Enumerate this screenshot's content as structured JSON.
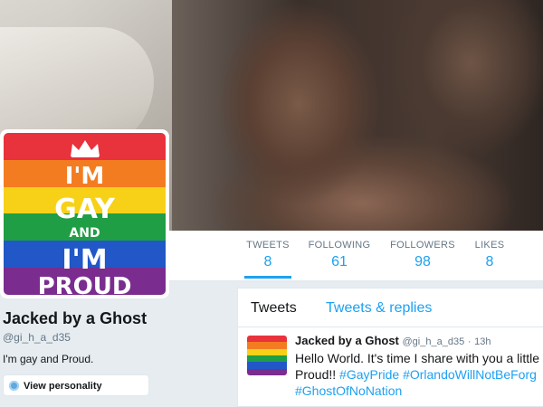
{
  "colors": {
    "accent": "#1da1f2",
    "muted": "#657786",
    "text": "#14171a",
    "flag": [
      "#e8323c",
      "#f47c20",
      "#f7d117",
      "#1f9e45",
      "#2157c7",
      "#7a2c8f"
    ]
  },
  "stats": [
    {
      "label": "TWEETS",
      "value": "8",
      "active": true
    },
    {
      "label": "FOLLOWING",
      "value": "61",
      "active": false
    },
    {
      "label": "FOLLOWERS",
      "value": "98",
      "active": false
    },
    {
      "label": "LIKES",
      "value": "8",
      "active": false
    }
  ],
  "avatar": {
    "lines": [
      "I'M",
      "GAY",
      "AND",
      "I'M",
      "PROUD"
    ],
    "icon": "crown-icon"
  },
  "profile": {
    "name": "Jacked by a Ghost",
    "handle": "@gi_h_a_d35",
    "bio": "I'm gay and Proud.",
    "personality_button": "View personality"
  },
  "tabs": [
    {
      "label": "Tweets",
      "active": true
    },
    {
      "label": "Tweets & replies",
      "active": false
    }
  ],
  "tweet": {
    "name": "Jacked by a Ghost",
    "handle": "@gi_h_a_d35",
    "time": "13h",
    "text_line1": "Hello World. It's time I share with you a little",
    "text_line2_plain": "Proud!! ",
    "hashtags_line2": "#GayPride #OrlandoWillNotBeForg",
    "hashtags_line3": "#GhostOfNoNation"
  }
}
